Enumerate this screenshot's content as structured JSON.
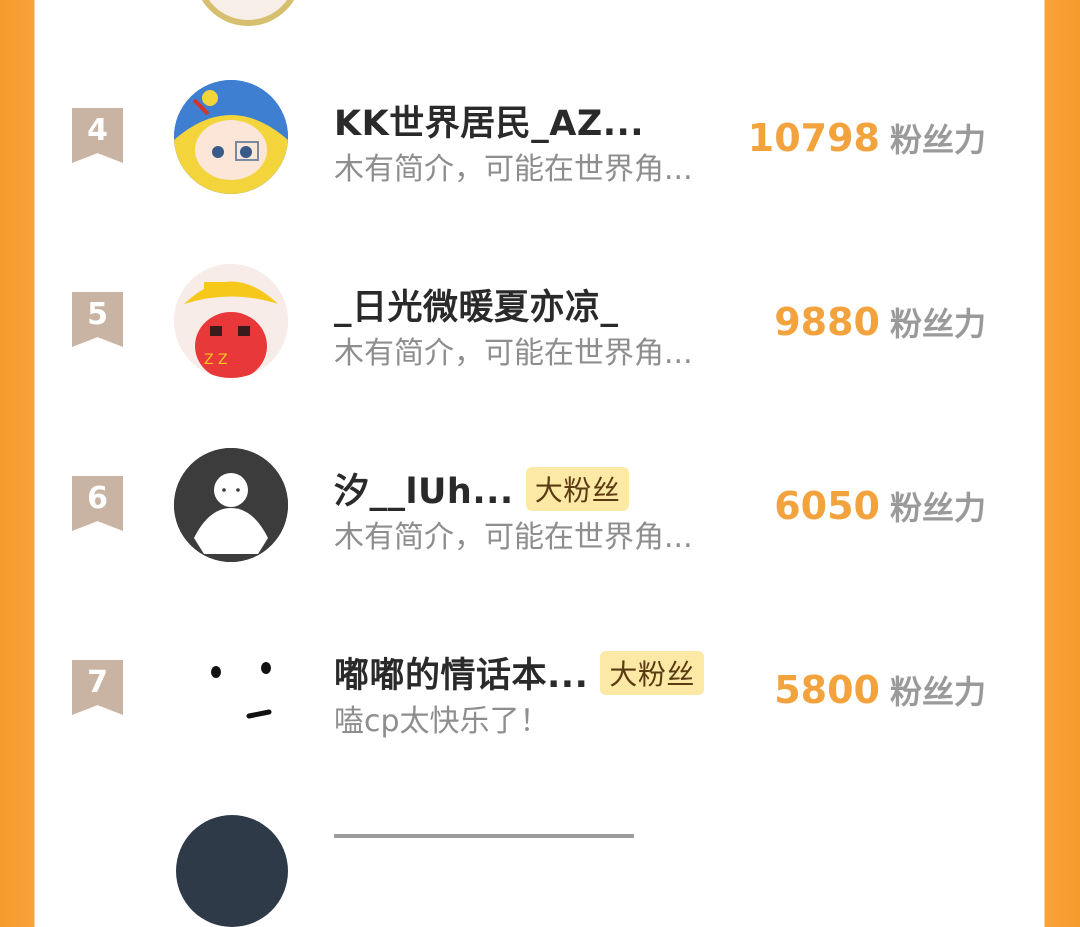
{
  "rows": [
    {
      "rank": "4",
      "name": "KK世界居民_AZ...",
      "desc": "木有简介，可能在世界角...",
      "score": "10798",
      "unit": "粉丝力",
      "badge": ""
    },
    {
      "rank": "5",
      "name": "_日光微暖夏亦凉_",
      "desc": "木有简介，可能在世界角...",
      "score": "9880",
      "unit": "粉丝力",
      "badge": ""
    },
    {
      "rank": "6",
      "name": "汐__lUh...",
      "desc": "木有简介，可能在世界角...",
      "score": "6050",
      "unit": "粉丝力",
      "badge": "大粉丝"
    },
    {
      "rank": "7",
      "name": "嘟嘟的情话本...",
      "desc": "嗑cp太快乐了！",
      "score": "5800",
      "unit": "粉丝力",
      "badge": "大粉丝"
    }
  ],
  "colors": {
    "accent": "#f3a33d",
    "border": "#f79a2c",
    "badge_bg": "#fde9a6"
  }
}
